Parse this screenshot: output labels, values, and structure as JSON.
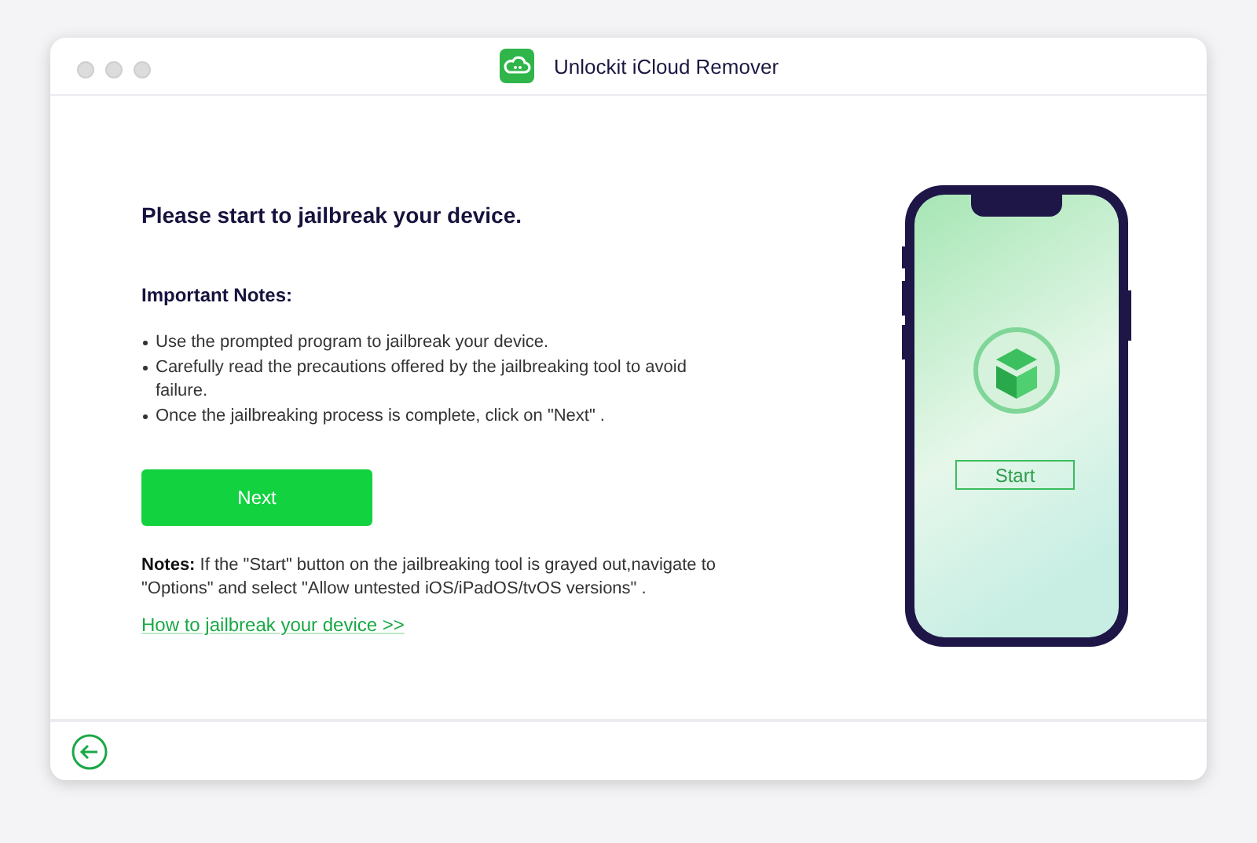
{
  "window": {
    "title": "Unlockit iCloud Remover"
  },
  "heading": "Please start to jailbreak your device.",
  "notes_title": "Important Notes:",
  "bullets": [
    "Use the prompted program to jailbreak your device.",
    "Carefully read the precautions offered by the jailbreaking tool to avoid failure.",
    "Once the jailbreaking process is complete, click on \"Next\" ."
  ],
  "next_button": "Next",
  "note": "**Notes:** If the \"Start\" button on the jailbreaking tool is grayed out,navigate to \"Options\" and select \"Allow untested iOS/iPadOS/tvOS versions\" .",
  "link": "How to jailbreak your device >>",
  "phone": {
    "button": "Start"
  }
}
